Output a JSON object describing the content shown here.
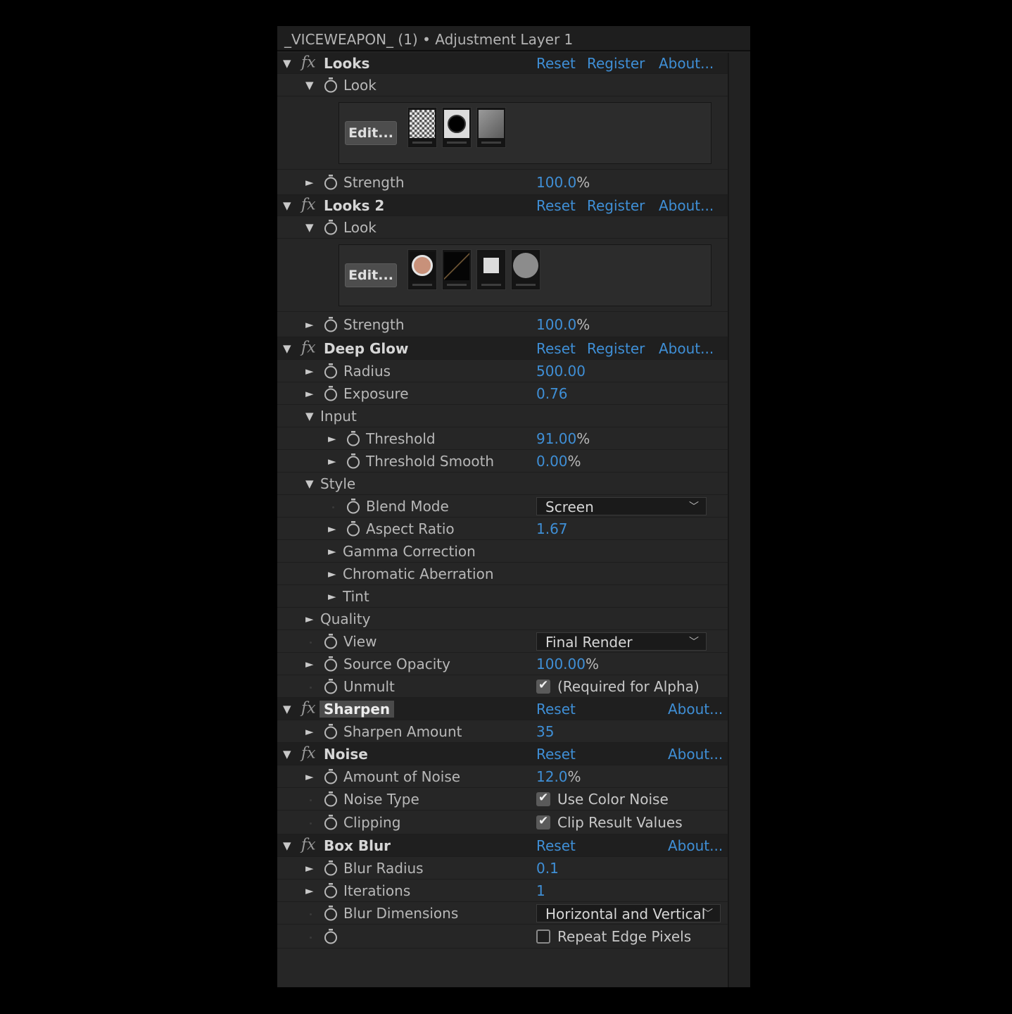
{
  "panel": {
    "title": "_VICEWEAPON_ (1) • Adjustment Layer 1"
  },
  "links": {
    "reset": "Reset",
    "register": "Register",
    "about": "About..."
  },
  "looks1": {
    "name": "Looks",
    "look_label": "Look",
    "edit_label": "Edit...",
    "strength_label": "Strength",
    "strength_value": "100.0",
    "strength_unit": "%"
  },
  "looks2": {
    "name": "Looks 2",
    "look_label": "Look",
    "edit_label": "Edit...",
    "strength_label": "Strength",
    "strength_value": "100.0",
    "strength_unit": "%"
  },
  "deep_glow": {
    "name": "Deep Glow",
    "radius_label": "Radius",
    "radius_value": "500.00",
    "exposure_label": "Exposure",
    "exposure_value": "0.76",
    "input_label": "Input",
    "threshold_label": "Threshold",
    "threshold_value": "91.00",
    "threshold_unit": "%",
    "threshold_smooth_label": "Threshold Smooth",
    "threshold_smooth_value": "0.00",
    "threshold_smooth_unit": "%",
    "style_label": "Style",
    "blend_mode_label": "Blend Mode",
    "blend_mode_value": "Screen",
    "aspect_ratio_label": "Aspect Ratio",
    "aspect_ratio_value": "1.67",
    "gamma_label": "Gamma Correction",
    "chromatic_label": "Chromatic Aberration",
    "tint_label": "Tint",
    "quality_label": "Quality",
    "view_label": "View",
    "view_value": "Final Render",
    "source_opacity_label": "Source Opacity",
    "source_opacity_value": "100.00",
    "source_opacity_unit": "%",
    "unmult_label": "Unmult",
    "unmult_checked": true,
    "unmult_text": "(Required for Alpha)"
  },
  "sharpen": {
    "name": "Sharpen",
    "amount_label": "Sharpen Amount",
    "amount_value": "35"
  },
  "noise": {
    "name": "Noise",
    "amount_label": "Amount of Noise",
    "amount_value": "12.0",
    "amount_unit": "%",
    "type_label": "Noise Type",
    "type_checked": true,
    "type_text": "Use Color Noise",
    "clipping_label": "Clipping",
    "clipping_checked": true,
    "clipping_text": "Clip Result Values"
  },
  "box_blur": {
    "name": "Box Blur",
    "radius_label": "Blur Radius",
    "radius_value": "0.1",
    "iterations_label": "Iterations",
    "iterations_value": "1",
    "dimensions_label": "Blur Dimensions",
    "dimensions_value": "Horizontal and Vertical",
    "repeat_checked": false,
    "repeat_text": "Repeat Edge Pixels"
  },
  "icons": {
    "twirl_open": "▼",
    "twirl_closed": "►",
    "stopwatch": "stopwatch-icon",
    "fx": "fx",
    "check": "✔",
    "chevron": "chevron-down-icon"
  },
  "colors": {
    "link": "#3f8fd6",
    "panel": "#262626",
    "header_row": "#1f1f1f"
  }
}
